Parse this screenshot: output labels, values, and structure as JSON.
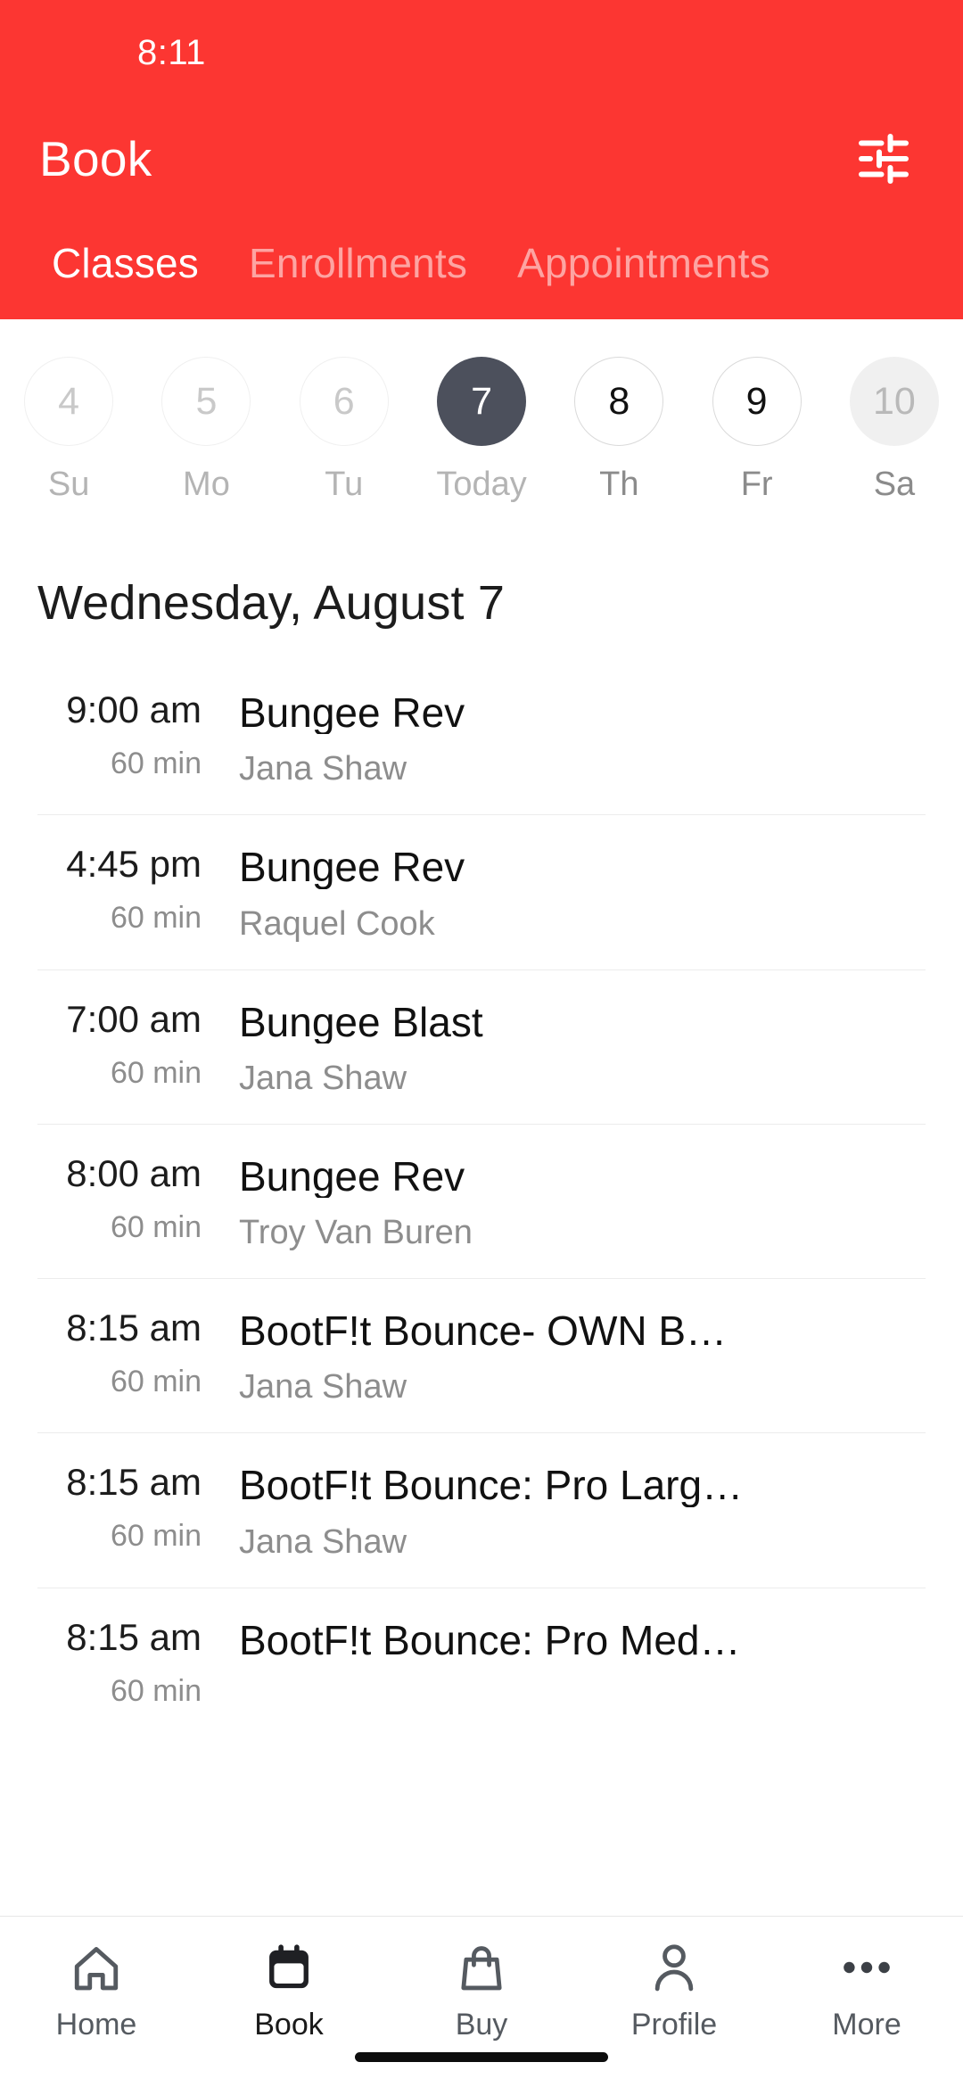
{
  "status_bar": {
    "time": "8:11"
  },
  "header": {
    "title": "Book",
    "filter_icon": "sliders-filter-icon",
    "accent_color": "#fc3632",
    "tabs": [
      {
        "label": "Classes",
        "active": true
      },
      {
        "label": "Enrollments",
        "active": false
      },
      {
        "label": "Appointments",
        "active": false
      }
    ]
  },
  "date_strip": {
    "days": [
      {
        "num": "4",
        "weekday": "Su",
        "state": "past"
      },
      {
        "num": "5",
        "weekday": "Mo",
        "state": "past"
      },
      {
        "num": "6",
        "weekday": "Tu",
        "state": "past"
      },
      {
        "num": "7",
        "weekday": "Today",
        "state": "selected"
      },
      {
        "num": "8",
        "weekday": "Th",
        "state": "future"
      },
      {
        "num": "9",
        "weekday": "Fr",
        "state": "future"
      },
      {
        "num": "10",
        "weekday": "Sa",
        "state": "muted"
      }
    ],
    "selected_color": "#4c505c"
  },
  "day_heading": "Wednesday, August 7",
  "classes": [
    {
      "time": "9:00 am",
      "duration": "60 min",
      "name": "Bungee Rev",
      "instructor": "Jana Shaw"
    },
    {
      "time": "4:45 pm",
      "duration": "60 min",
      "name": "Bungee Rev",
      "instructor": "Raquel Cook"
    },
    {
      "time": "7:00 am",
      "duration": "60 min",
      "name": "Bungee Blast",
      "instructor": "Jana Shaw"
    },
    {
      "time": "8:00 am",
      "duration": "60 min",
      "name": "Bungee Rev",
      "instructor": "Troy Van Buren"
    },
    {
      "time": "8:15 am",
      "duration": "60 min",
      "name": "BootF!t Bounce- OWN B…",
      "instructor": "Jana Shaw"
    },
    {
      "time": "8:15 am",
      "duration": "60 min",
      "name": "BootF!t Bounce: Pro Larg…",
      "instructor": "Jana Shaw"
    },
    {
      "time": "8:15 am",
      "duration": "60 min",
      "name": "BootF!t Bounce: Pro Med…",
      "instructor": ""
    }
  ],
  "bottom_nav": {
    "items": [
      {
        "label": "Home",
        "icon": "home-icon",
        "active": false
      },
      {
        "label": "Book",
        "icon": "calendar-icon",
        "active": true
      },
      {
        "label": "Buy",
        "icon": "shopping-bag-icon",
        "active": false
      },
      {
        "label": "Profile",
        "icon": "person-icon",
        "active": false
      },
      {
        "label": "More",
        "icon": "ellipsis-icon",
        "active": false
      }
    ]
  }
}
